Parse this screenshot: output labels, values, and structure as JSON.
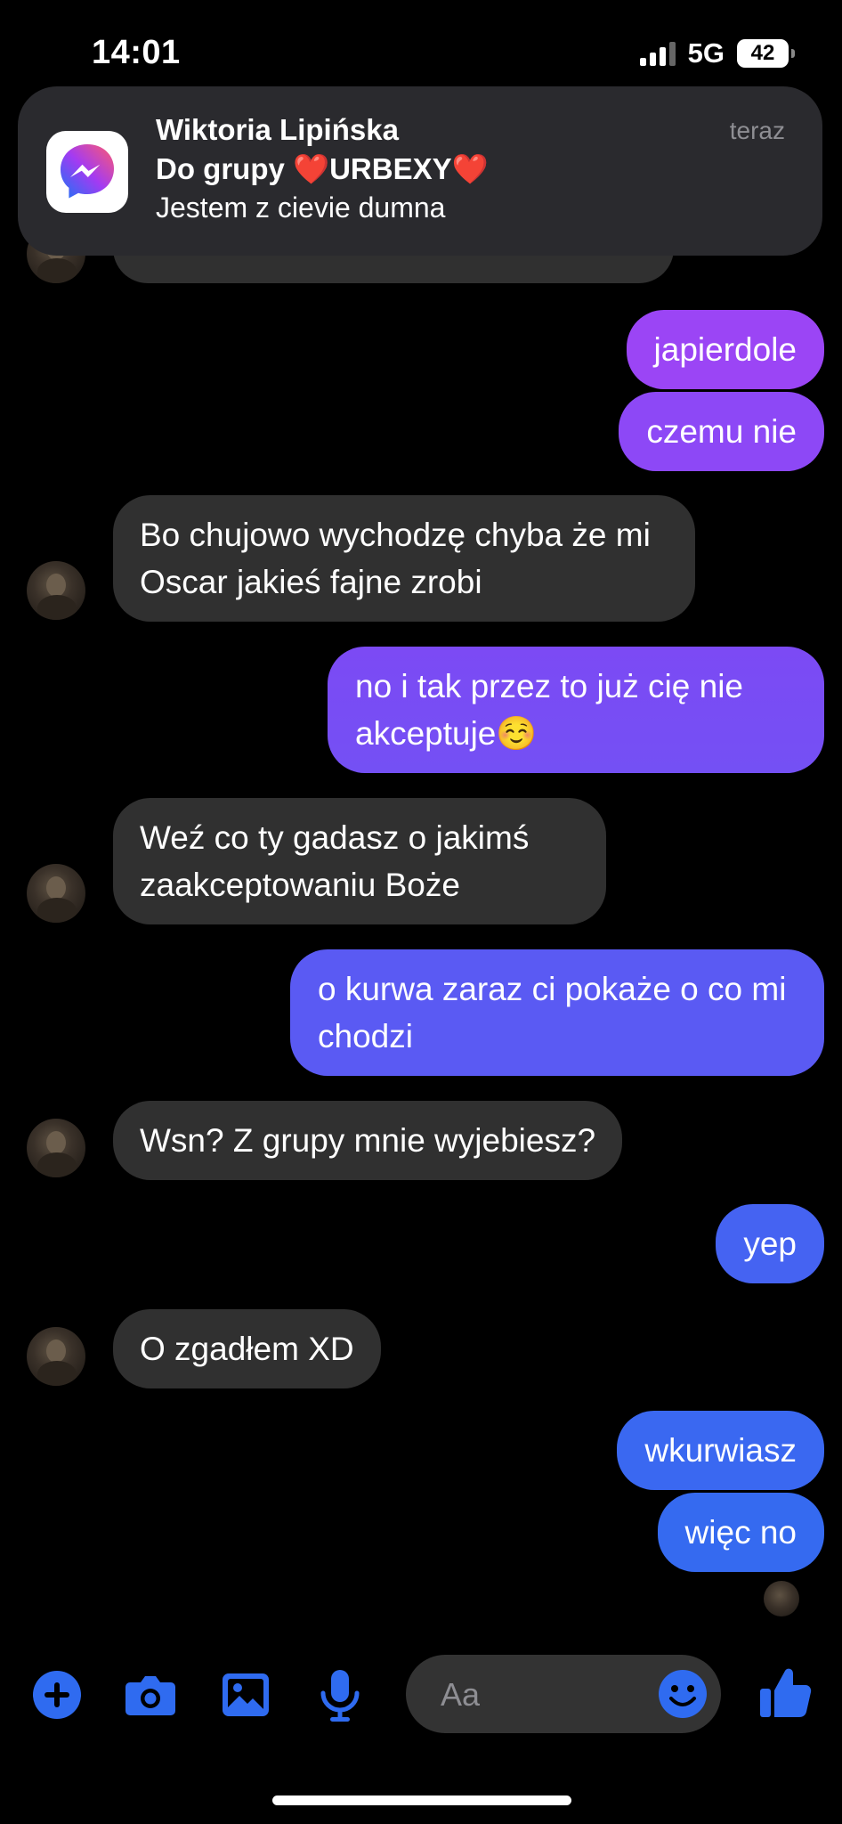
{
  "status_bar": {
    "time": "14:01",
    "network": "5G",
    "battery": "42"
  },
  "notification": {
    "sender": "Wiktoria Lipińska",
    "group_line": "Do grupy ❤️URBEXY❤️",
    "body": "Jestem z cievie dumna",
    "time": "teraz"
  },
  "messages": [
    {
      "direction": "sent",
      "text": "japierdole"
    },
    {
      "direction": "sent",
      "text": "czemu nie"
    },
    {
      "direction": "received",
      "text": "Bo chujowo wychodzę chyba że mi Oscar jakieś fajne zrobi"
    },
    {
      "direction": "sent",
      "text": "no i tak przez to już cię nie akceptuje☺️"
    },
    {
      "direction": "received",
      "text": "Weź co ty gadasz o jakimś zaakceptowaniu Boże"
    },
    {
      "direction": "sent",
      "text": "o kurwa zaraz ci pokaże o co mi chodzi"
    },
    {
      "direction": "received",
      "text": "Wsn? Z grupy mnie wyjebiesz?"
    },
    {
      "direction": "sent",
      "text": "yep"
    },
    {
      "direction": "received",
      "text": "O zgadłem XD"
    },
    {
      "direction": "sent",
      "text": "wkurwiasz"
    },
    {
      "direction": "sent",
      "text": "więc no"
    }
  ],
  "composer": {
    "placeholder": "Aa"
  },
  "icons": {
    "add": "plus-circle-icon",
    "camera": "camera-icon",
    "gallery": "image-icon",
    "mic": "microphone-icon",
    "emoji": "smiley-icon",
    "like": "thumbs-up-icon"
  },
  "colors": {
    "accent": "#2f6bf0",
    "sent_top": "#9b45f5",
    "sent_bottom": "#2f6bf0",
    "received": "#303030"
  }
}
